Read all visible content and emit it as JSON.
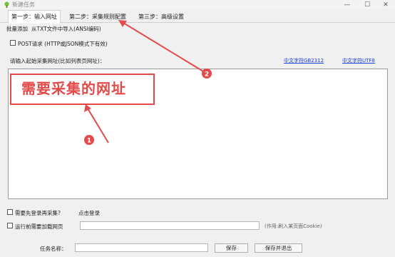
{
  "window": {
    "title": "新建任务",
    "minimize": "—",
    "maximize": "☐",
    "close": "✕"
  },
  "tabs": [
    {
      "label": "第一步：输入网址",
      "active": true
    },
    {
      "label": "第二步：采集规则配置",
      "active": false
    },
    {
      "label": "第三步：高级设置",
      "active": false
    }
  ],
  "toolbar": {
    "batch_add": "批量添加",
    "import_txt": "从TXT文件中导入(ANSI编码)"
  },
  "post_request": {
    "label": "POST请求 (HTTP或JSON模式下有效)",
    "checked": false
  },
  "url_section": {
    "prompt": "请输入起始采集网址(比如列表页网址)：",
    "link_gb2312": "中文字符GB2312",
    "link_utf8": "中文字符UTF8",
    "annotation": "需要采集的网址"
  },
  "login": {
    "label": "需要先登录再采集?",
    "checked": false,
    "link": "点击登录"
  },
  "preload": {
    "label": "运行前需要加载网页",
    "checked": false,
    "hint": "(作用:刷入某页面Cookie)"
  },
  "task": {
    "name_label": "任务名称：",
    "name_value": "",
    "save": "保存",
    "save_exit": "保存并退出"
  },
  "callouts": [
    {
      "number": "1"
    },
    {
      "number": "2"
    }
  ],
  "colors": {
    "annotation_red": "#e44a4a",
    "link_blue": "#1a3fd6"
  }
}
